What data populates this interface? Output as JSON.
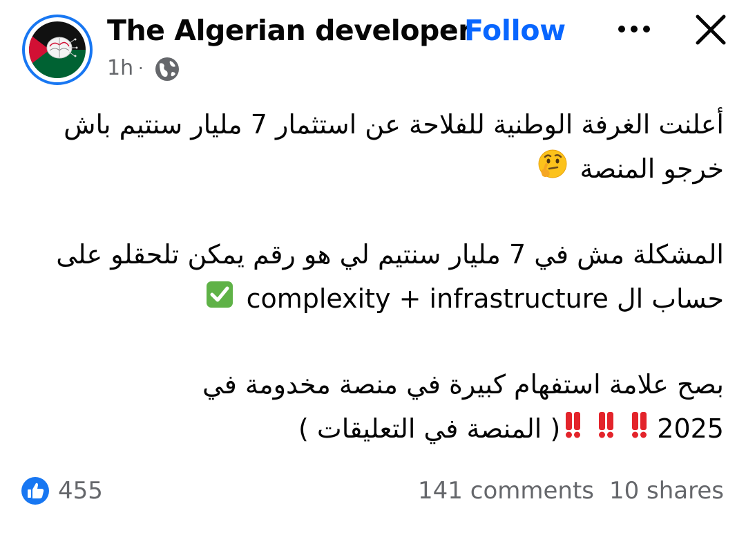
{
  "header": {
    "page_name": "The Algerian developer",
    "separator": "·",
    "follow_label": "Follow",
    "time": "1h",
    "time_separator": "·",
    "audience_icon": "globe-icon",
    "more_icon": "more-horizontal-icon",
    "close_icon": "close-icon",
    "avatar_caption": "The Algerian developer"
  },
  "post": {
    "line_1": "أعلنت الغرفة الوطنية للفلاحة عن استثمار 7 مليار سنتيم باش",
    "line_2": "خرجو المنصة",
    "line_2_emoji": "thinking-face",
    "line_3": "المشكلة مش في 7 مليار سنتيم لي هو رقم يمكن تلحقلو على",
    "line_4": "حساب ال complexity + infrastructure",
    "line_4_emoji": "check-mark-button",
    "line_5": "بصح علامة استفهام كبيرة في منصة مخدومة في",
    "line_6": "2025",
    "line_6_emoji": "double-exclamation-mark x3",
    "line_6_end": "( المنصة في التعليقات )"
  },
  "stats": {
    "reactions": "455",
    "comments": "141 comments",
    "shares": "10 shares"
  },
  "colors": {
    "accent": "#0866ff",
    "avatar_ring": "#1877f2",
    "secondary_text": "#65676b",
    "like_badge": "#1877f2",
    "red_flag": "#d21034",
    "green_flag": "#006233"
  }
}
